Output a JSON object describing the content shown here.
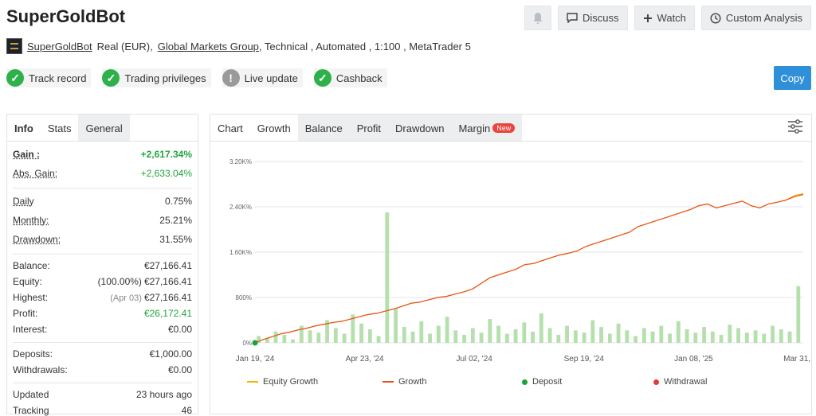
{
  "header": {
    "title": "SuperGoldBot",
    "actions": {
      "discuss": "Discuss",
      "watch": "Watch",
      "custom": "Custom Analysis"
    }
  },
  "meta": {
    "name": "SuperGoldBot",
    "account": "Real (EUR),",
    "broker": "Global Markets Group",
    "details": ", Technical , Automated , 1:100 , MetaTrader 5"
  },
  "badges": [
    "Track record",
    "Trading privileges",
    "Live update",
    "Cashback"
  ],
  "copy_label": "Copy",
  "left_tabs": [
    "Info",
    "Stats",
    "General"
  ],
  "stats": {
    "gain": {
      "label": "Gain :",
      "value": "+2,617.34%"
    },
    "abs_gain": {
      "label": "Abs. Gain:",
      "value": "+2,633.04%"
    },
    "daily": {
      "label": "Daily",
      "value": "0.75%"
    },
    "monthly": {
      "label": "Monthly:",
      "value": "25.21%"
    },
    "drawdown": {
      "label": "Drawdown:",
      "value": "31.55%"
    },
    "balance": {
      "label": "Balance:",
      "value": "€27,166.41"
    },
    "equity": {
      "label": "Equity:",
      "pre": "(100.00%)",
      "value": "€27,166.41"
    },
    "highest": {
      "label": "Highest:",
      "pre": "(Apr 03)",
      "value": "€27,166.41"
    },
    "profit": {
      "label": "Profit:",
      "value": "€26,172.41"
    },
    "interest": {
      "label": "Interest:",
      "value": "€0.00"
    },
    "deposits": {
      "label": "Deposits:",
      "value": "€1,000.00"
    },
    "withdrawals": {
      "label": "Withdrawals:",
      "value": "€0.00"
    },
    "updated": {
      "label": "Updated",
      "value": "23 hours ago"
    },
    "tracking": {
      "label": "Tracking",
      "value": "46"
    }
  },
  "right_tabs": [
    "Chart",
    "Growth",
    "Balance",
    "Profit",
    "Drawdown",
    "Margin"
  ],
  "new_badge": "New",
  "colors": {
    "equity": "#f5b400",
    "growth": "#e8501e",
    "deposit": "#1aa33a",
    "withdrawal": "#e53935",
    "bars": "#b5e0ad",
    "accent": "#2f8fd8"
  },
  "chart_data": {
    "type": "line",
    "x_labels": [
      "Jan 19, '24",
      "Apr 23, '24",
      "Jul 02, '24",
      "Sep 19, '24",
      "Jan 08, '25",
      "Mar 31, '25"
    ],
    "y_labels": [
      "3.20K%",
      "2.40K%",
      "1.60K%",
      "800%",
      "0%"
    ],
    "ylim": [
      0,
      3200
    ],
    "series": [
      {
        "name": "Growth",
        "values": [
          0,
          60,
          110,
          160,
          190,
          230,
          260,
          300,
          330,
          360,
          380,
          420,
          460,
          500,
          520,
          560,
          600,
          650,
          700,
          720,
          760,
          800,
          820,
          860,
          900,
          950,
          1050,
          1150,
          1200,
          1250,
          1300,
          1380,
          1400,
          1450,
          1500,
          1550,
          1580,
          1620,
          1700,
          1750,
          1800,
          1850,
          1900,
          1950,
          2050,
          2100,
          2150,
          2200,
          2250,
          2300,
          2350,
          2420,
          2450,
          2380,
          2420,
          2460,
          2500,
          2420,
          2380,
          2450,
          2480,
          2520,
          2580,
          2617
        ]
      },
      {
        "name": "Equity Growth",
        "values": [
          0,
          60,
          110,
          160,
          190,
          230,
          260,
          300,
          330,
          360,
          380,
          420,
          460,
          500,
          520,
          560,
          600,
          650,
          700,
          720,
          760,
          800,
          820,
          860,
          900,
          950,
          1050,
          1150,
          1200,
          1250,
          1300,
          1380,
          1400,
          1450,
          1500,
          1550,
          1580,
          1620,
          1700,
          1750,
          1800,
          1850,
          1900,
          1950,
          2050,
          2100,
          2150,
          2200,
          2250,
          2300,
          2350,
          2420,
          2450,
          2380,
          2420,
          2460,
          2500,
          2420,
          2380,
          2450,
          2480,
          2520,
          2600,
          2633
        ]
      }
    ],
    "bars": [
      120,
      80,
      200,
      140,
      60,
      300,
      220,
      180,
      400,
      260,
      160,
      500,
      340,
      240,
      120,
      2300,
      600,
      280,
      200,
      380,
      160,
      300,
      460,
      220,
      140,
      260,
      180,
      420,
      300,
      160,
      240,
      360,
      200,
      520,
      260,
      140,
      300,
      220,
      180,
      400,
      280,
      160,
      340,
      220,
      120,
      260,
      200,
      300,
      160,
      380,
      240,
      180,
      280,
      200,
      140,
      320,
      260,
      180,
      220,
      160,
      300,
      240,
      200,
      1000
    ],
    "legend": [
      "Equity Growth",
      "Growth",
      "Deposit",
      "Withdrawal"
    ],
    "legend_position": "bottom"
  }
}
